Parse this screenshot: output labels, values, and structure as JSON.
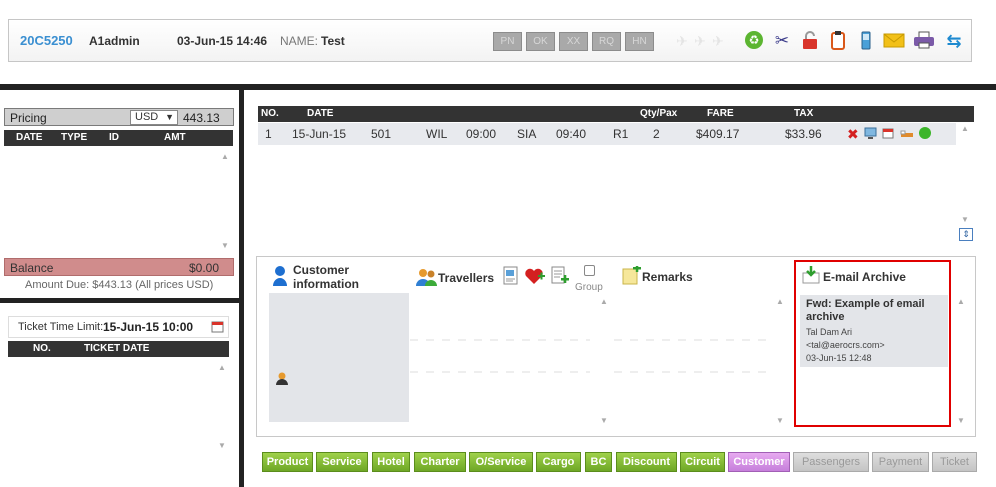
{
  "header": {
    "booking_code": "20C5250",
    "agent": "A1admin",
    "datetime": "03-Jun-15 14:46",
    "name_label": "NAME:",
    "name_value": "Test",
    "status_buttons": [
      "PN",
      "OK",
      "XX",
      "RQ",
      "HN"
    ],
    "toolbar_icons": [
      "plane-icon",
      "plane-icon",
      "plane-icon",
      "recycle-icon",
      "scissors-icon",
      "lock-icon",
      "clipboard-icon",
      "mobile-icon",
      "mail-icon",
      "printer-icon",
      "sync-icon"
    ]
  },
  "pricing": {
    "label": "Pricing",
    "currency": "USD",
    "amount": "443.13",
    "columns": [
      "DATE",
      "TYPE",
      "ID",
      "AMT"
    ],
    "balance_label": "Balance",
    "balance_value": "$0.00",
    "amount_due": "Amount Due: $443.13 (All prices USD)"
  },
  "ticket": {
    "time_limit_label": "Ticket Time Limit:",
    "time_limit_value": "15-Jun-15 10:00",
    "columns": [
      "NO.",
      "TICKET DATE"
    ]
  },
  "segments": {
    "columns": [
      "NO.",
      "DATE",
      "Qty/Pax",
      "FARE",
      "TAX"
    ],
    "rows": [
      {
        "no": "1",
        "date": "15-Jun-15",
        "flight": "501",
        "from": "WIL",
        "dep": "09:00",
        "to": "SIA",
        "arr": "09:40",
        "class": "R1",
        "qty": "2",
        "fare": "$409.17",
        "tax": "$33.96"
      }
    ]
  },
  "panels": {
    "customer_title_1": "Customer",
    "customer_title_2": "information",
    "travellers_title": "Travellers",
    "group_label": "Group",
    "remarks_title": "Remarks",
    "email_title": "E-mail Archive",
    "email": {
      "subject": "Fwd: Example of email archive",
      "from_name": "Tal Dam Ari",
      "from_addr": "<tal@aerocrs.com>",
      "date": "03-Jun-15 12:48"
    }
  },
  "bottom_buttons": [
    "Product",
    "Service",
    "Hotel",
    "Charter",
    "O/Service",
    "Cargo",
    "BC",
    "Discount",
    "Circuit",
    "Customer",
    "Passengers",
    "Payment",
    "Ticket"
  ],
  "colors": {
    "accent_blue": "#3a8fd1",
    "balance_red": "#d08c8c",
    "green_button": "#7cb82f",
    "purple_button": "#d08fe0",
    "highlight_border": "#e00000"
  }
}
